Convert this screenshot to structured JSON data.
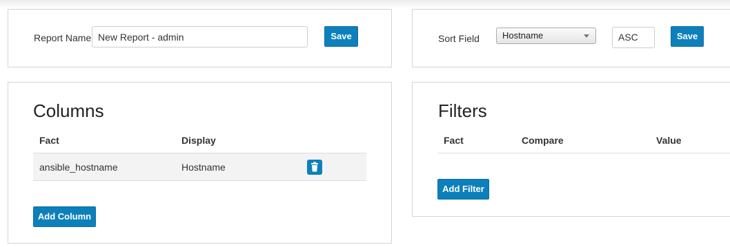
{
  "report": {
    "name_label": "Report Name",
    "name_value": "New Report - admin",
    "save_label": "Save"
  },
  "sort": {
    "field_label": "Sort Field",
    "field_value": "Hostname",
    "order_value": "ASC",
    "save_label": "Save"
  },
  "columns": {
    "title": "Columns",
    "headers": {
      "fact": "Fact",
      "display": "Display"
    },
    "rows": [
      {
        "fact": "ansible_hostname",
        "display": "Hostname"
      }
    ],
    "add_label": "Add Column"
  },
  "filters": {
    "title": "Filters",
    "headers": {
      "fact": "Fact",
      "compare": "Compare",
      "value": "Value"
    },
    "add_label": "Add Filter"
  },
  "colors": {
    "accent": "#0d80bb",
    "row_bg": "#f3f3f3",
    "border": "#d4d4d4"
  },
  "icons": {
    "delete": "trash-icon",
    "dropdown": "chevron-down-icon"
  }
}
